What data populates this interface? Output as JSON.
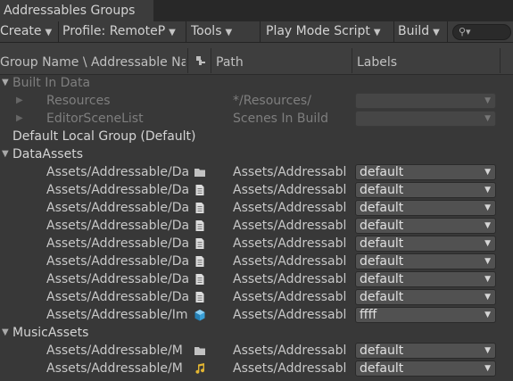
{
  "window": {
    "tab_title": "Addressables Groups"
  },
  "toolbar": {
    "create": "Create",
    "profile": "Profile: RemoteP",
    "tools": "Tools",
    "play_mode": "Play Mode Script",
    "build": "Build",
    "search_placeholder": ""
  },
  "columns": {
    "name": "Group Name \\ Addressable Na",
    "path": "Path",
    "labels": "Labels"
  },
  "groups": {
    "built_in": {
      "label": "Built In Data",
      "entries": [
        {
          "name": "Resources",
          "path": "*/Resources/"
        },
        {
          "name": "EditorSceneList",
          "path": "Scenes In Build"
        }
      ]
    },
    "default_local": {
      "label": "Default Local Group (Default)"
    },
    "data_assets": {
      "label": "DataAssets",
      "entries": [
        {
          "name": "Assets/Addressable/Da",
          "path": "Assets/Addressabl",
          "label": "default",
          "icon": "folder-icon"
        },
        {
          "name": "Assets/Addressable/Da",
          "path": "Assets/Addressabl",
          "label": "default",
          "icon": "document-icon"
        },
        {
          "name": "Assets/Addressable/Da",
          "path": "Assets/Addressabl",
          "label": "default",
          "icon": "document-icon"
        },
        {
          "name": "Assets/Addressable/Da",
          "path": "Assets/Addressabl",
          "label": "default",
          "icon": "document-icon"
        },
        {
          "name": "Assets/Addressable/Da",
          "path": "Assets/Addressabl",
          "label": "default",
          "icon": "document-icon"
        },
        {
          "name": "Assets/Addressable/Da",
          "path": "Assets/Addressabl",
          "label": "default",
          "icon": "document-icon"
        },
        {
          "name": "Assets/Addressable/Da",
          "path": "Assets/Addressabl",
          "label": "default",
          "icon": "document-icon"
        },
        {
          "name": "Assets/Addressable/Da",
          "path": "Assets/Addressabl",
          "label": "default",
          "icon": "document-icon"
        },
        {
          "name": "Assets/Addressable/Im",
          "path": "Assets/Addressabl",
          "label": "ffff",
          "icon": "cube-icon"
        }
      ]
    },
    "music_assets": {
      "label": "MusicAssets",
      "entries": [
        {
          "name": "Assets/Addressable/M",
          "path": "Assets/Addressabl",
          "label": "default",
          "icon": "folder-icon"
        },
        {
          "name": "Assets/Addressable/M",
          "path": "Assets/Addressabl",
          "label": "default",
          "icon": "music-note-icon"
        }
      ]
    }
  },
  "colors": {
    "background": "#383838",
    "toolbar": "#3c3c3c",
    "dropdown": "#515151",
    "cube": "#3aa0d8",
    "music": "#e2b531"
  }
}
